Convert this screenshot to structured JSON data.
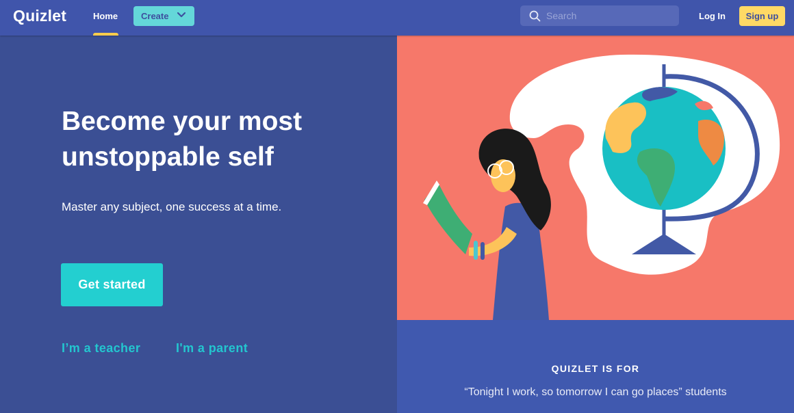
{
  "header": {
    "logo": "Quizlet",
    "nav": {
      "home_label": "Home",
      "home_active": true
    },
    "create_label": "Create",
    "search": {
      "placeholder": "Search",
      "value": ""
    },
    "login_label": "Log In",
    "signup_label": "Sign up"
  },
  "hero": {
    "headline": "Become your most unstoppable self",
    "subline": "Master any subject, one success at a time.",
    "cta_label": "Get started",
    "links": [
      {
        "label": "I’m a teacher"
      },
      {
        "label": "I'm a parent"
      }
    ]
  },
  "illustration": {
    "description": "girl-reading-book-with-globe"
  },
  "quizlet_for": {
    "title": "QUIZLET IS FOR",
    "quote": "“Tonight I work, so tomorrow I can go places” students"
  },
  "colors": {
    "nav_bg": "#4055ab",
    "hero_bg": "#3b4f94",
    "accent_teal": "#23cfd0",
    "signup_yellow": "#ffd965",
    "illustration_bg": "#f6786a"
  }
}
